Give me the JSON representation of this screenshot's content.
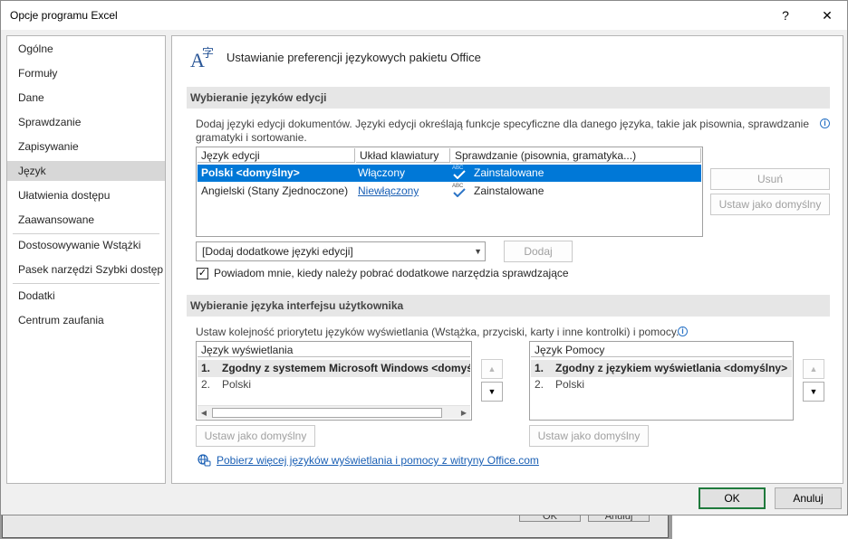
{
  "window": {
    "title": "Opcje programu Excel",
    "help_glyph": "?",
    "close_glyph": "✕"
  },
  "nav": {
    "items": [
      {
        "label": "Ogólne"
      },
      {
        "label": "Formuły"
      },
      {
        "label": "Dane"
      },
      {
        "label": "Sprawdzanie"
      },
      {
        "label": "Zapisywanie"
      },
      {
        "label": "Język"
      },
      {
        "label": "Ułatwienia dostępu"
      },
      {
        "label": "Zaawansowane"
      },
      {
        "label": "Dostosowywanie Wstążki"
      },
      {
        "label": "Pasek narzędzi Szybki dostęp"
      },
      {
        "label": "Dodatki"
      },
      {
        "label": "Centrum zaufania"
      }
    ],
    "selected": "Język"
  },
  "header": {
    "title": "Ustawianie preferencji językowych pakietu Office",
    "icon_glyph_a": "A",
    "icon_glyph_b": "字"
  },
  "editing": {
    "section_title": "Wybieranie języków edycji",
    "description": "Dodaj języki edycji dokumentów. Języki edycji określają funkcje specyficzne dla danego języka, takie jak pisownia, sprawdzanie gramatyki i sortowanie.",
    "columns": [
      "Język edycji",
      "Układ klawiatury",
      "Sprawdzanie (pisownia, gramatyka...)"
    ],
    "rows": [
      {
        "language": "Polski <domyślny>",
        "keyboard": "Włączony",
        "proofing": "Zainstalowane",
        "abc": "ABC"
      },
      {
        "language": "Angielski (Stany Zjednoczone)",
        "keyboard": "Niewłączony",
        "proofing": "Zainstalowane",
        "abc": "ABC"
      }
    ],
    "remove_button": "Usuń",
    "set_default_button": "Ustaw jako domyślny",
    "add_combo_value": "[Dodaj dodatkowe języki edycji]",
    "add_button": "Dodaj",
    "notify_checkbox_label": "Powiadom mnie, kiedy należy pobrać dodatkowe narzędzia sprawdzające",
    "notify_checked": true
  },
  "display": {
    "section_title": "Wybieranie języka interfejsu użytkownika",
    "description": "Ustaw kolejność priorytetu języków wyświetlania (Wstążka, przyciski, karty i inne kontrolki) i pomocy.",
    "display_list": {
      "header": "Język wyświetlania",
      "items": [
        {
          "num": "1.",
          "label": "Zgodny z systemem Microsoft Windows <domyślny>"
        },
        {
          "num": "2.",
          "label": "Polski"
        }
      ]
    },
    "help_list": {
      "header": "Język Pomocy",
      "items": [
        {
          "num": "1.",
          "label": "Zgodny z językiem wyświetlania <domyślny>"
        },
        {
          "num": "2.",
          "label": "Polski"
        }
      ]
    },
    "set_default_display_button": "Ustaw jako domyślny",
    "set_default_help_button": "Ustaw jako domyślny",
    "download_link": "Pobierz więcej języków wyświetlania i pomocy z witryny Office.com"
  },
  "footer": {
    "ok_button": "OK",
    "cancel_button": "Anuluj"
  },
  "background_dialog": {
    "ok_button": "OK",
    "cancel_button": "Anuluj"
  }
}
